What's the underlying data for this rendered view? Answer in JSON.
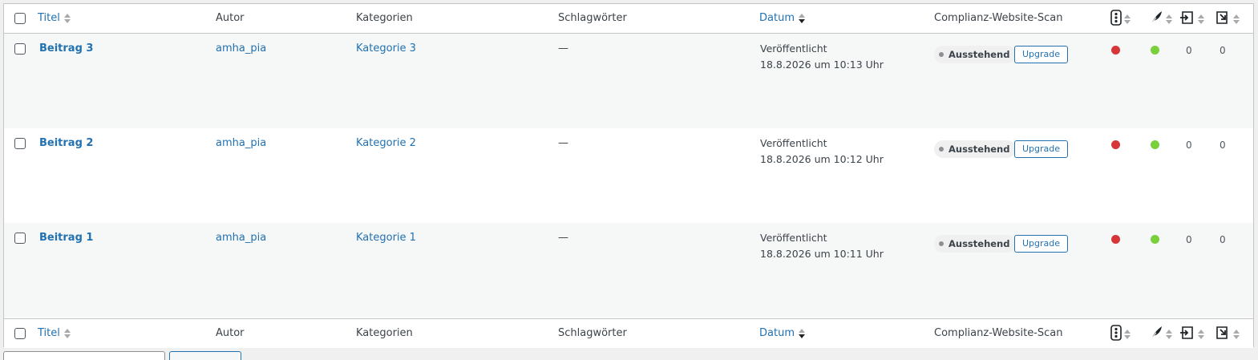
{
  "columns": {
    "title": "Titel",
    "author": "Autor",
    "categories": "Kategorien",
    "tags": "Schlagwörter",
    "date": "Datum",
    "scan": "Complianz-Website-Scan"
  },
  "rows": [
    {
      "title": "Beitrag 3",
      "author": "amha_pia",
      "category": "Kategorie 3",
      "tags": "—",
      "status": "Veröffentlicht",
      "date": "18.8.2026 um 10:13 Uhr",
      "badge": "Ausstehend",
      "button": "Upgrade",
      "count_a": "0",
      "count_b": "0"
    },
    {
      "title": "Beitrag 2",
      "author": "amha_pia",
      "category": "Kategorie 2",
      "tags": "—",
      "status": "Veröffentlicht",
      "date": "18.8.2026 um 10:12 Uhr",
      "badge": "Ausstehend",
      "button": "Upgrade",
      "count_a": "0",
      "count_b": "0"
    },
    {
      "title": "Beitrag 1",
      "author": "amha_pia",
      "category": "Kategorie 1",
      "tags": "—",
      "status": "Veröffentlicht",
      "date": "18.8.2026 um 10:11 Uhr",
      "badge": "Ausstehend",
      "button": "Upgrade",
      "count_a": "0",
      "count_b": "0"
    }
  ],
  "icons": {
    "traffic": "traffic-light-icon",
    "feather": "feather-icon",
    "inbound": "inbound-links-icon",
    "outbound": "outbound-links-icon"
  },
  "colors": {
    "link": "#2271b1",
    "seo_bad": "#d63638",
    "readability_good": "#7ad03a"
  }
}
